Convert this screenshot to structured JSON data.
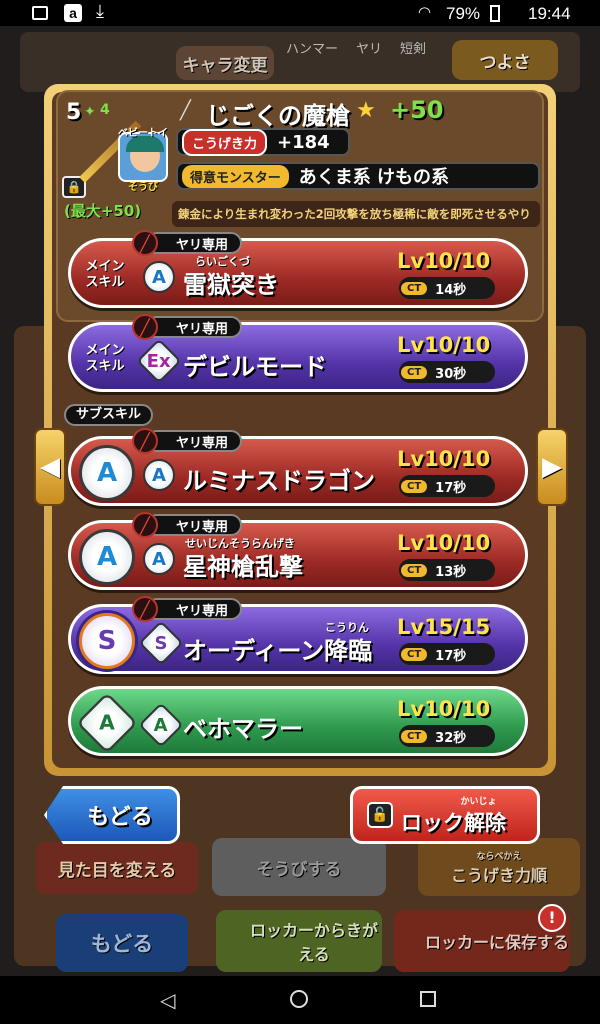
{
  "status_bar": {
    "battery": "79%",
    "time": "19:44",
    "icons": [
      "notification-icon",
      "amazon-icon",
      "download-icon",
      "wifi-icon",
      "battery-icon"
    ]
  },
  "background": {
    "chara_change": "キャラ変更",
    "tsuyosa": "つよさ",
    "weapon_tabs": [
      "ハンマー",
      "ヤリ",
      "短剣"
    ],
    "back_label": "もどる",
    "mitame": "見た目を変える",
    "soubi": "そうびする",
    "sort_ruby": "ならべかえ",
    "sort": "こうげき力順",
    "locker_get": "ロッカーからきがえる",
    "locker_save": "ロッカーに保存する"
  },
  "weapon": {
    "stars": "5",
    "plus_small": "4",
    "name": "じごくの魔槍",
    "plus": "+50",
    "max_label": "(最大+50)",
    "portrait_name": "ベビートイ",
    "portrait_sub": "そうび",
    "attack_label": "こうげき力",
    "attack_value": "+184",
    "monster_label": "得意モンスター",
    "monster_value": "あくま系 けもの系",
    "description": "錬金により生まれ変わった2回攻撃を放ち極稀に敵を即死させるやり"
  },
  "main_skills": [
    {
      "side": [
        "メイン",
        "スキル"
      ],
      "tag": "ヤリ専用",
      "badge": "A",
      "ruby": "らいごくづ",
      "name": "雷獄突き",
      "level": "Lv10/10",
      "ct_label": "CT",
      "ct": "14秒"
    },
    {
      "side": [
        "メイン",
        "スキル"
      ],
      "tag": "ヤリ専用",
      "badge": "Ex",
      "ruby": "",
      "name": "デビルモード",
      "level": "Lv10/10",
      "ct_label": "CT",
      "ct": "30秒"
    }
  ],
  "sub_label": "サブスキル",
  "sub_skills": [
    {
      "tag": "ヤリ専用",
      "badge": "A",
      "ruby": "",
      "name": "ルミナスドラゴン",
      "level": "Lv10/10",
      "ct_label": "CT",
      "ct": "17秒"
    },
    {
      "tag": "ヤリ専用",
      "badge": "A",
      "ruby": "せいじんそうらんげき",
      "name": "星神槍乱撃",
      "level": "Lv10/10",
      "ct_label": "CT",
      "ct": "13秒"
    },
    {
      "tag": "ヤリ専用",
      "badge": "S",
      "ruby": "こうりん",
      "name": "オーディーン降臨",
      "level": "Lv15/15",
      "ct_label": "CT",
      "ct": "17秒"
    },
    {
      "tag": "",
      "badge": "A",
      "ruby": "",
      "name": "ベホマラー",
      "level": "Lv10/10",
      "ct_label": "CT",
      "ct": "32秒"
    }
  ],
  "buttons": {
    "back": "もどる",
    "unlock_ruby": "かいじょ",
    "unlock": "ロック解除"
  },
  "colors": {
    "accent_green": "#7ee04a",
    "level_yellow": "#ffe34d",
    "card_red": "#9d2a25",
    "card_purple": "#5434a8",
    "card_green": "#2e9a4d"
  }
}
